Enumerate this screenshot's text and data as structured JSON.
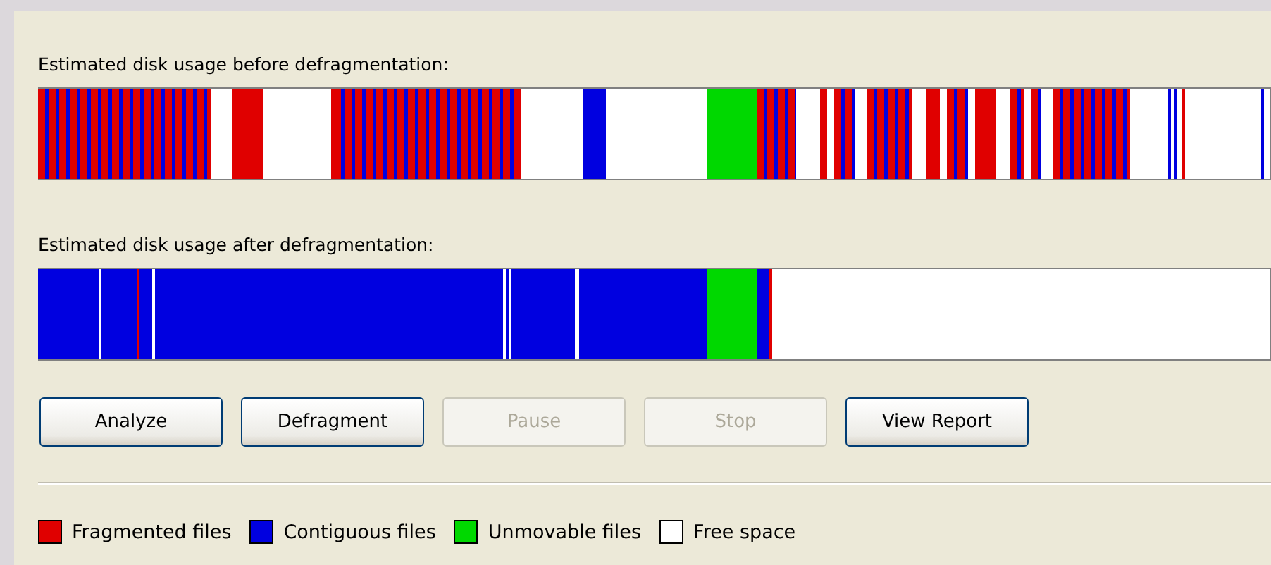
{
  "before_label": "Estimated disk usage before defragmentation:",
  "after_label": "Estimated disk usage after defragmentation:",
  "buttons": [
    {
      "label": "Analyze",
      "disabled": false
    },
    {
      "label": "Defragment",
      "disabled": false
    },
    {
      "label": "Pause",
      "disabled": true
    },
    {
      "label": "Stop",
      "disabled": true
    },
    {
      "label": "View Report",
      "disabled": false
    }
  ],
  "legend": [
    {
      "label": "Fragmented files",
      "color": "#e00000"
    },
    {
      "label": "Contiguous files",
      "color": "#0000e0"
    },
    {
      "label": "Unmovable files",
      "color": "#00d800"
    },
    {
      "label": "Free space",
      "color": "#ffffff"
    }
  ]
}
